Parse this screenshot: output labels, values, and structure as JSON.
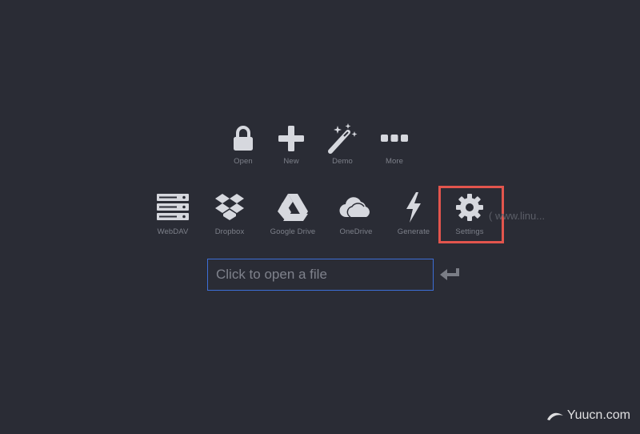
{
  "toolbar_primary": {
    "open": {
      "label": "Open",
      "icon": "lock-icon"
    },
    "new": {
      "label": "New",
      "icon": "plus-icon"
    },
    "demo": {
      "label": "Demo",
      "icon": "magic-wand-icon"
    },
    "more": {
      "label": "More",
      "icon": "ellipsis-icon"
    }
  },
  "toolbar_storage": {
    "webdav": {
      "label": "WebDAV",
      "icon": "server-icon"
    },
    "dropbox": {
      "label": "Dropbox",
      "icon": "dropbox-icon"
    },
    "google_drive": {
      "label": "Google Drive",
      "icon": "google-drive-icon"
    },
    "onedrive": {
      "label": "OneDrive",
      "icon": "cloud-icon"
    },
    "generate": {
      "label": "Generate",
      "icon": "lightning-icon"
    },
    "settings": {
      "label": "Settings",
      "icon": "gear-icon"
    }
  },
  "file_input": {
    "placeholder": "Click to open a file",
    "value": ""
  },
  "side_hint": "( www.linu...",
  "watermark": "Yuucn.com",
  "colors": {
    "background": "#2a2c35",
    "icon": "#d6d8de",
    "label": "#7d808a",
    "input_border": "#3d6ed6",
    "highlight": "#e2554d"
  }
}
